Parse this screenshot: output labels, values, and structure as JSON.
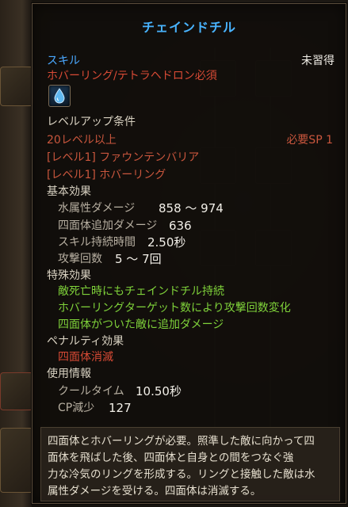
{
  "tooltip": {
    "title": "チェインドチル",
    "type_label": "スキル",
    "status": "未習得",
    "requirement": "ホバーリング/テトラヘドロン必須",
    "levelup_heading": "レベルアップ条件",
    "level_req": "20レベル以上",
    "sp_req": "必要SP 1",
    "prereq_1": "[レベル1] ファウンテンバリア",
    "prereq_2": "[レベル1] ホバーリング",
    "basic_heading": "基本効果",
    "basic_effects": [
      {
        "label": "水属性ダメージ",
        "value": "858 ～ 974"
      },
      {
        "label": "四面体追加ダメージ",
        "value": "636"
      },
      {
        "label": "スキル持続時間",
        "value": "2.50秒"
      },
      {
        "label": "攻撃回数",
        "value": "5 ～ 7回"
      }
    ],
    "special_heading": "特殊効果",
    "special_effects": [
      "敵死亡時にもチェインドチル持続",
      "ホバーリングターゲット数により攻撃回数変化",
      "四面体がついた敵に追加ダメージ"
    ],
    "penalty_heading": "ペナルティ効果",
    "penalty_effect": "四面体消滅",
    "usage_heading": "使用情報",
    "usage": [
      {
        "label": "クールタイム",
        "value": "10.50秒"
      },
      {
        "label": "CP減少",
        "value": "127"
      }
    ],
    "description_lines": [
      "四面体とホバーリングが必要。照準した敵に向かって四",
      "面体を飛ばした後、四面体と自身との間をつなぐ強",
      "力な冷気のリングを形成する。リングと接触した敵は水",
      "属性ダメージを受ける。四面体は消滅する。"
    ]
  },
  "icons": {
    "skill": "water-drop-icon"
  },
  "colors": {
    "title": "#49b4ff",
    "requirement": "#d84a35",
    "special": "#7fd23a",
    "panel_bg": "#110e0b"
  }
}
